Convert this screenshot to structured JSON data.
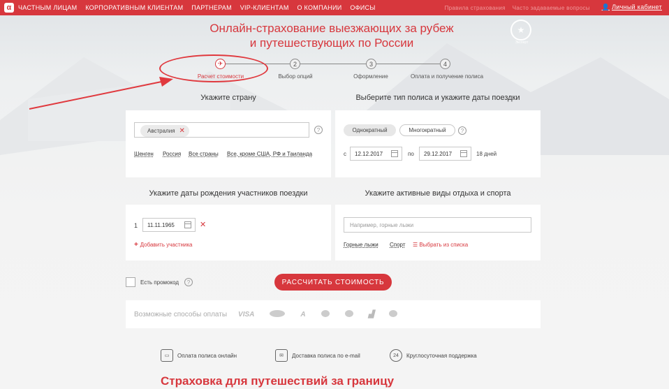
{
  "nav": {
    "logo": "α",
    "items": [
      "ЧАСТНЫМ ЛИЦАМ",
      "КОРПОРАТИВНЫМ КЛИЕНТАМ",
      "ПАРТНЕРАМ",
      "VIP-КЛИЕНТАМ",
      "О КОМПАНИИ",
      "ОФИСЫ"
    ],
    "ghost_links": [
      "Правила страхования",
      "Часто задаваемые вопросы"
    ],
    "cabinet": "Личный кабинет"
  },
  "title_line1": "Онлайн-страхование выезжающих за рубеж",
  "title_line2": "и путешествующих по России",
  "badge_sub": "Эксперт",
  "steps": [
    {
      "num": "✈",
      "label": "Расчет стоимости",
      "active": true
    },
    {
      "num": "2",
      "label": "Выбор опций",
      "active": false
    },
    {
      "num": "3",
      "label": "Оформление",
      "active": false
    },
    {
      "num": "4",
      "label": "Оплата и получение полиса",
      "active": false
    }
  ],
  "country": {
    "heading": "Укажите страну",
    "tag": "Австралия",
    "tag_remove": "✕",
    "quick_links": [
      "Шенген",
      "Россия",
      "Все страны",
      "Все, кроме США, РФ и Таиланда"
    ]
  },
  "policy": {
    "heading": "Выберите тип полиса и укажите даты поездки",
    "type_single": "Однократный",
    "type_multi": "Многократный",
    "from_label": "с",
    "from_date": "12.12.2017",
    "to_label": "по",
    "to_date": "29.12.2017",
    "days": "18 дней"
  },
  "participants": {
    "heading": "Укажите даты рождения участников поездки",
    "row_num": "1",
    "birth_date": "11.11.1965",
    "remove": "✕",
    "add_label": "Добавить участника"
  },
  "activities": {
    "heading": "Укажите активные виды отдыха и спорта",
    "placeholder": "Например, горные лыжи",
    "quick_links": [
      "Горные лыжи",
      "Спорт"
    ],
    "choose_label": "Выбрать из списка"
  },
  "promo_label": "Есть промокод",
  "calculate_button": "РАССЧИТАТЬ СТОИМОСТЬ",
  "payment": {
    "label": "Возможные способы оплаты",
    "visa": "VISA"
  },
  "features": [
    {
      "icon": "monitor-icon",
      "label": "Оплата полиса онлайн"
    },
    {
      "icon": "envelope-icon",
      "label": "Доставка полиса по e-mail"
    },
    {
      "icon": "clock-24-icon",
      "glyph": "24",
      "label": "Круглосуточная поддержка"
    }
  ],
  "bottom_title": "Страховка для путешествий за границу",
  "colors": {
    "accent": "#d7373d"
  }
}
